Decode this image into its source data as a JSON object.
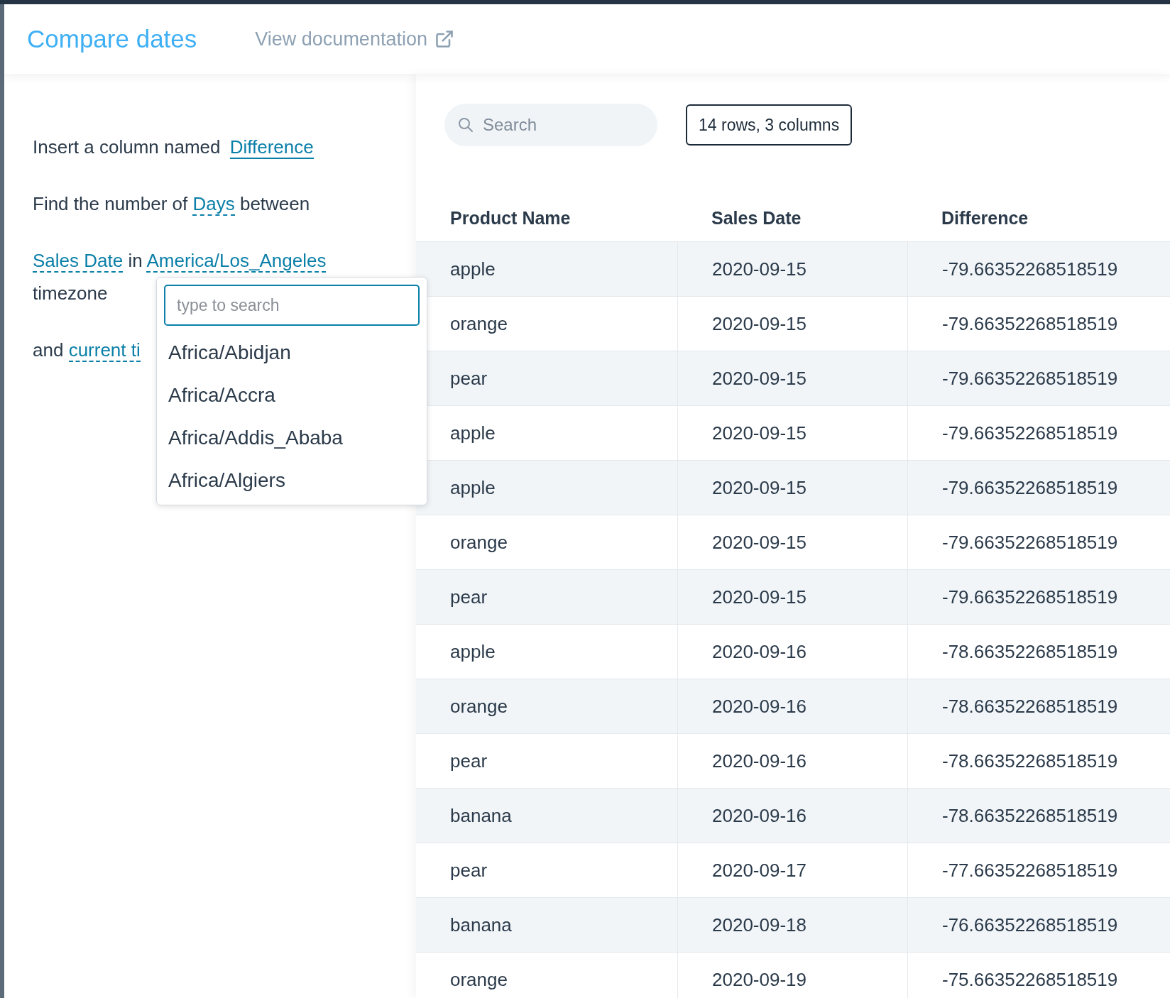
{
  "header": {
    "title": "Compare dates",
    "doc_link": "View documentation"
  },
  "builder": {
    "sentences": [
      [
        {
          "kind": "text",
          "text": "Insert a column named"
        },
        {
          "kind": "field",
          "text": "Difference"
        }
      ],
      [
        {
          "kind": "text",
          "text": "Find the number of"
        },
        {
          "kind": "link",
          "text": "Days"
        },
        {
          "kind": "text",
          "text": "between"
        }
      ],
      [
        {
          "kind": "link",
          "text": "Sales Date"
        },
        {
          "kind": "text",
          "text": "in"
        },
        {
          "kind": "link",
          "text": "America/Los_Angeles"
        },
        {
          "kind": "text",
          "text": "timezone"
        }
      ],
      [
        {
          "kind": "text",
          "text": "and"
        },
        {
          "kind": "link",
          "text": "current ti"
        }
      ]
    ]
  },
  "dropdown": {
    "placeholder": "type to search",
    "options": [
      "Africa/Abidjan",
      "Africa/Accra",
      "Africa/Addis_Ababa",
      "Africa/Algiers"
    ]
  },
  "table": {
    "search_placeholder": "Search",
    "summary": "14 rows, 3 columns",
    "columns": [
      "Product Name",
      "Sales Date",
      "Difference"
    ],
    "rows": [
      [
        "apple",
        "2020-09-15",
        "-79.66352268518519"
      ],
      [
        "orange",
        "2020-09-15",
        "-79.66352268518519"
      ],
      [
        "pear",
        "2020-09-15",
        "-79.66352268518519"
      ],
      [
        "apple",
        "2020-09-15",
        "-79.66352268518519"
      ],
      [
        "apple",
        "2020-09-15",
        "-79.66352268518519"
      ],
      [
        "orange",
        "2020-09-15",
        "-79.66352268518519"
      ],
      [
        "pear",
        "2020-09-15",
        "-79.66352268518519"
      ],
      [
        "apple",
        "2020-09-16",
        "-78.66352268518519"
      ],
      [
        "orange",
        "2020-09-16",
        "-78.66352268518519"
      ],
      [
        "pear",
        "2020-09-16",
        "-78.66352268518519"
      ],
      [
        "banana",
        "2020-09-16",
        "-78.66352268518519"
      ],
      [
        "pear",
        "2020-09-17",
        "-77.66352268518519"
      ],
      [
        "banana",
        "2020-09-18",
        "-76.66352268518519"
      ],
      [
        "orange",
        "2020-09-19",
        "-75.66352268518519"
      ]
    ]
  }
}
